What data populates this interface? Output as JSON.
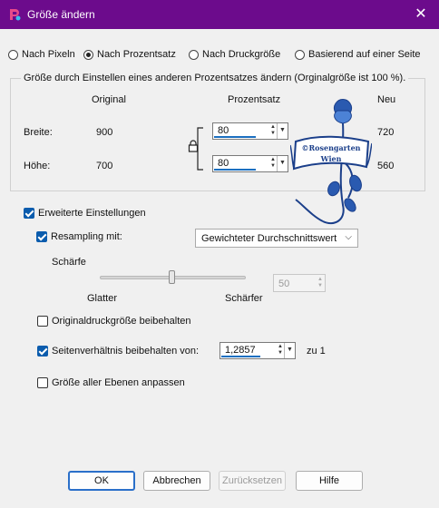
{
  "window": {
    "title": "Größe ändern",
    "close_glyph": "✕",
    "accent": "#6c0b8c"
  },
  "modes": [
    {
      "label": "Nach Pixeln",
      "selected": false
    },
    {
      "label": "Nach Prozentsatz",
      "selected": true
    },
    {
      "label": "Nach Druckgröße",
      "selected": false
    },
    {
      "label": "Basierend auf einer Seite",
      "selected": false
    }
  ],
  "size_group": {
    "caption": "Größe durch Einstellen eines anderen Prozentsatzes ändern (Orginalgröße ist 100 %).",
    "col_original": "Original",
    "col_percent": "Prozentsatz",
    "col_new": "Neu",
    "width_label": "Breite:",
    "width_original": "900",
    "width_percent": "80",
    "width_new": "720",
    "height_label": "Höhe:",
    "height_original": "700",
    "height_percent": "80",
    "height_new": "560",
    "watermark_line1": "©Rosengarten",
    "watermark_line2": "Wien"
  },
  "advanced": {
    "label": "Erweiterte Einstellungen",
    "checked": true
  },
  "resampling": {
    "label": "Resampling mit:",
    "checked": true,
    "method": "Gewichteter Durchschnittswert"
  },
  "sharpness": {
    "label": "Schärfe",
    "left_label": "Glatter",
    "right_label": "Schärfer",
    "value": "50",
    "level": 0.5
  },
  "options": {
    "keep_print_size": {
      "label": "Originaldruckgröße beibehalten",
      "checked": false
    },
    "keep_aspect": {
      "label": "Seitenverhältnis beibehalten von:",
      "checked": true,
      "value": "1,2857",
      "suffix": "zu 1"
    },
    "resize_all_layers": {
      "label": "Größe aller Ebenen anpassen",
      "checked": false
    }
  },
  "buttons": {
    "ok": "OK",
    "cancel": "Abbrechen",
    "reset": "Zurücksetzen",
    "help": "Hilfe"
  }
}
